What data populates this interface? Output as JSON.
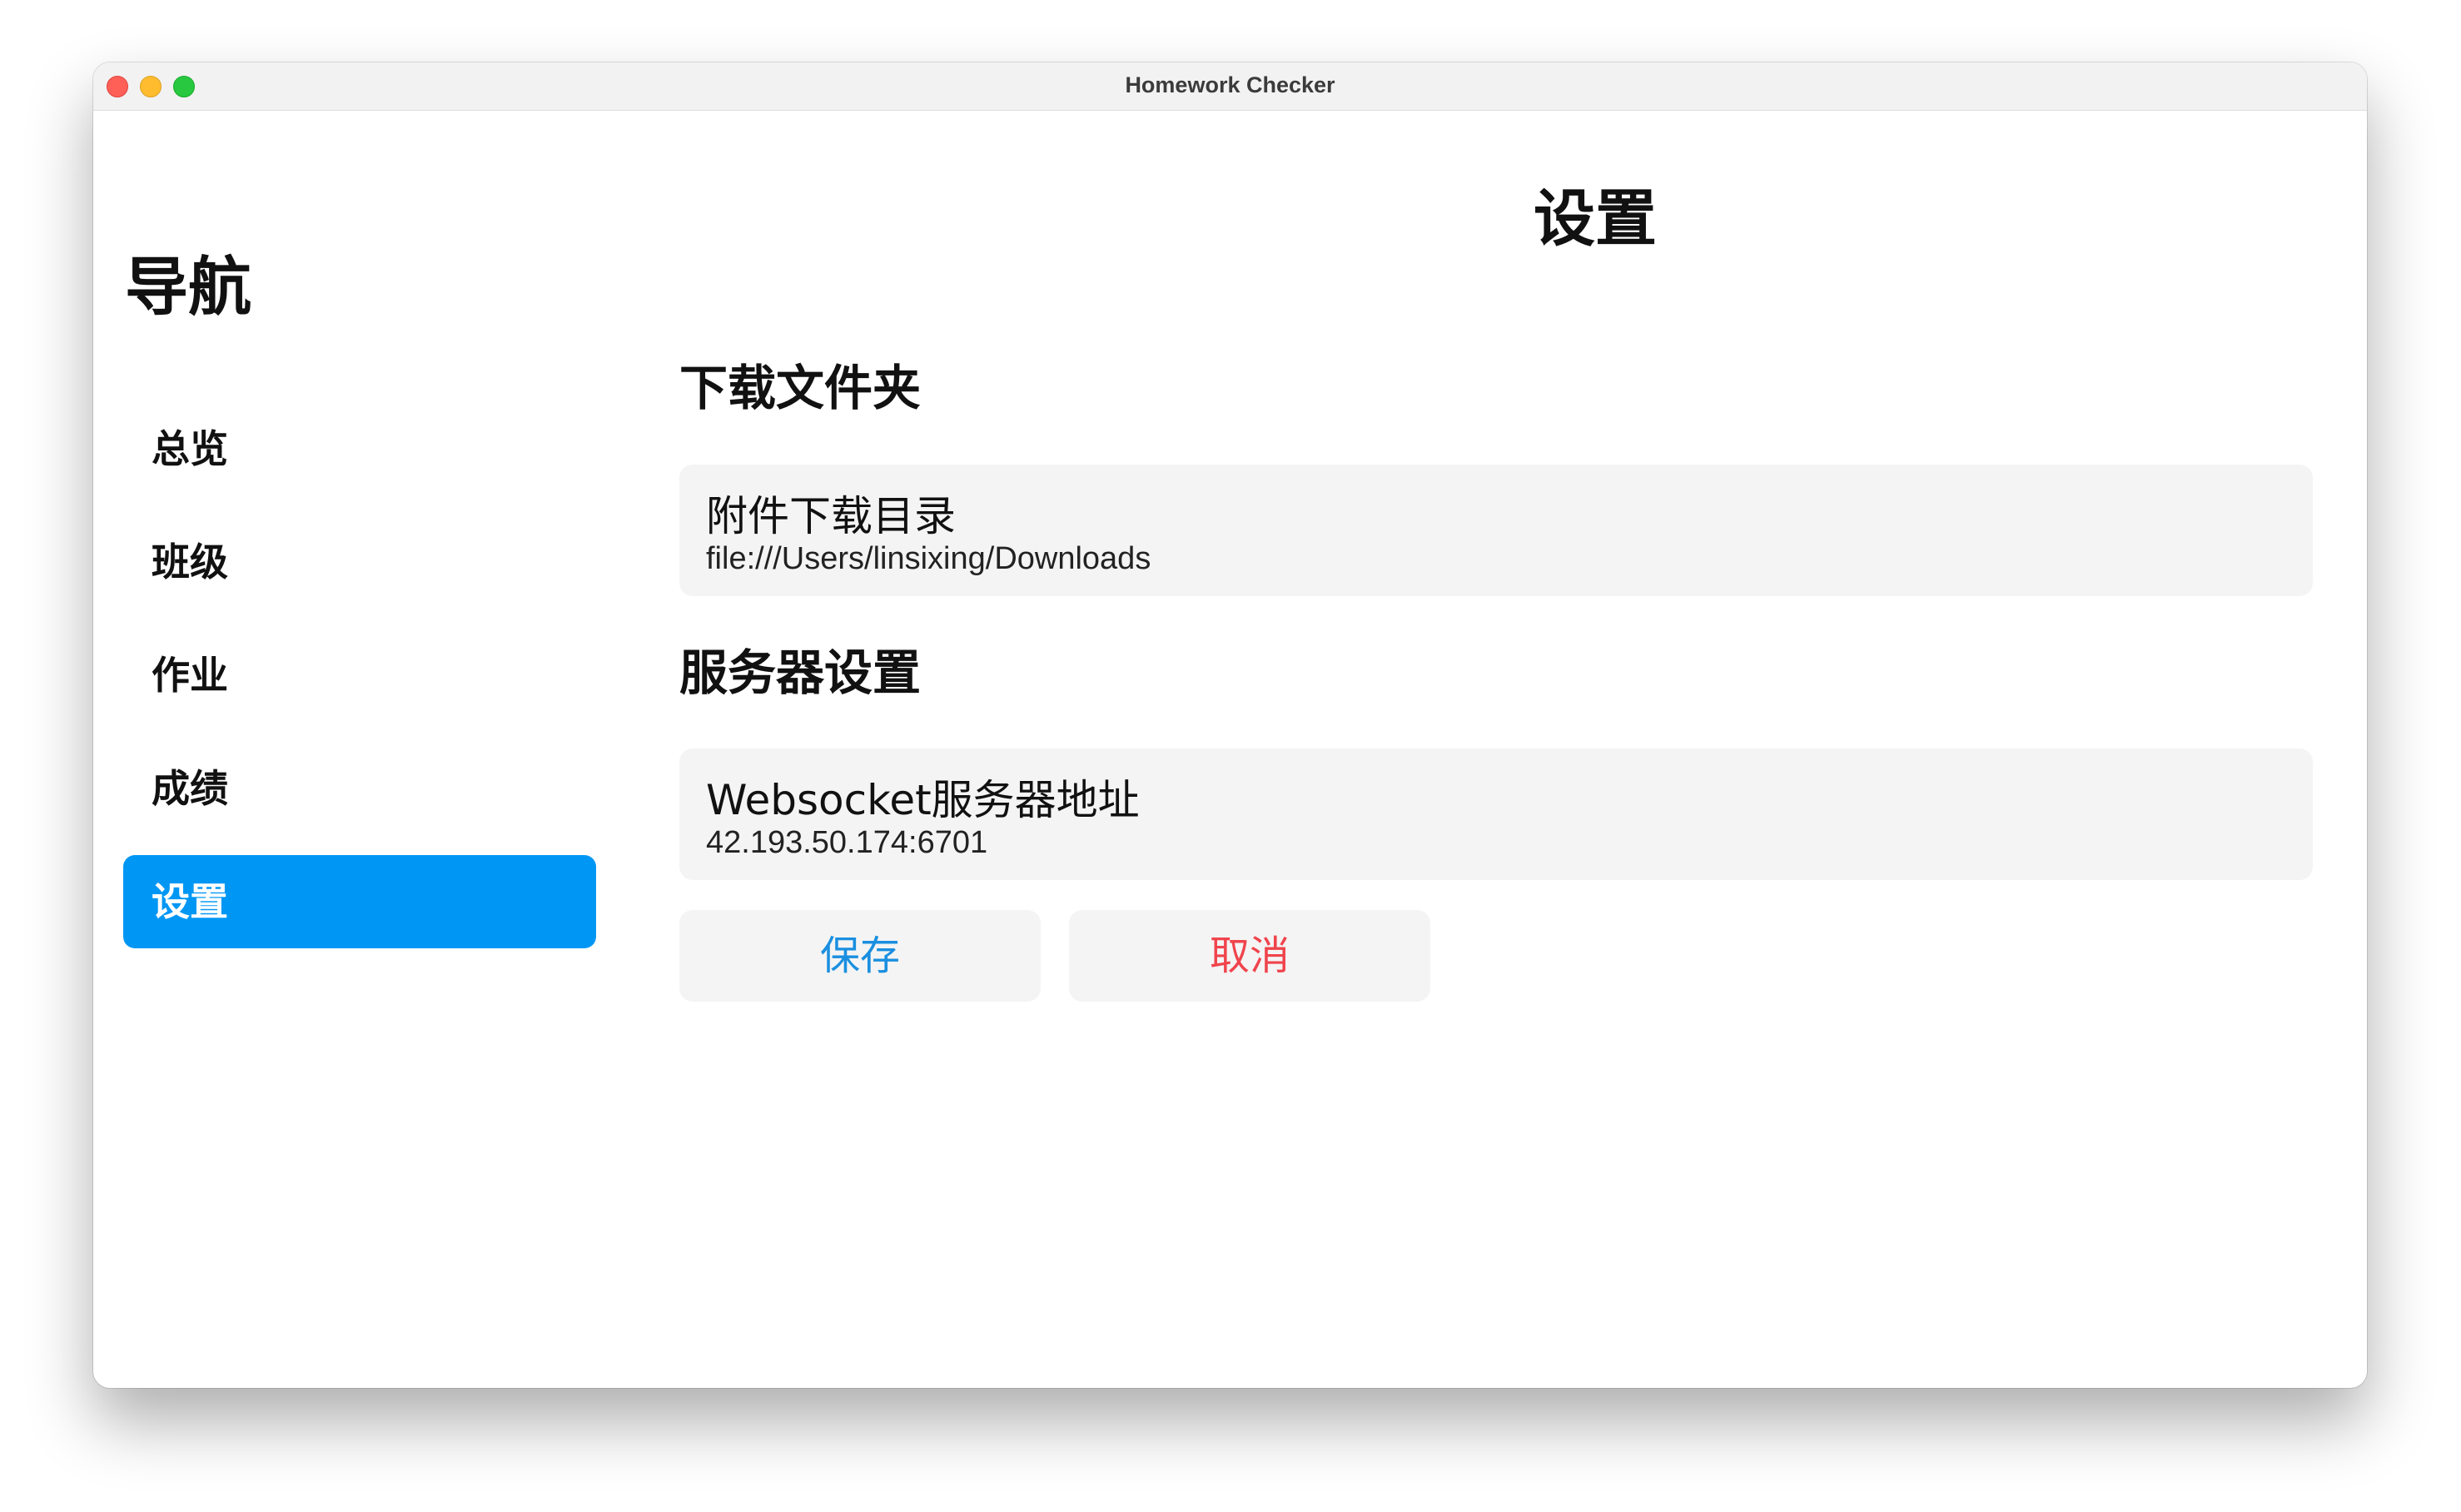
{
  "window": {
    "title": "Homework Checker"
  },
  "nav": {
    "title": "导航",
    "items": [
      {
        "label": "总览"
      },
      {
        "label": "班级"
      },
      {
        "label": "作业"
      },
      {
        "label": "成绩"
      },
      {
        "label": "设置",
        "active": true
      }
    ]
  },
  "main": {
    "page_title": "设置",
    "download_section": {
      "title": "下载文件夹",
      "field_label": "附件下载目录",
      "field_value": "file:///Users/linsixing/Downloads"
    },
    "server_section": {
      "title": "服务器设置",
      "field_label": "Websocket服务器地址",
      "field_value": "42.193.50.174:6701"
    },
    "buttons": {
      "save_label": "保存",
      "cancel_label": "取消"
    }
  },
  "colors": {
    "accent": "#0097f4",
    "save_text": "#1a8fe0",
    "cancel_text": "#f0444c",
    "card_bg": "#f4f4f4"
  }
}
